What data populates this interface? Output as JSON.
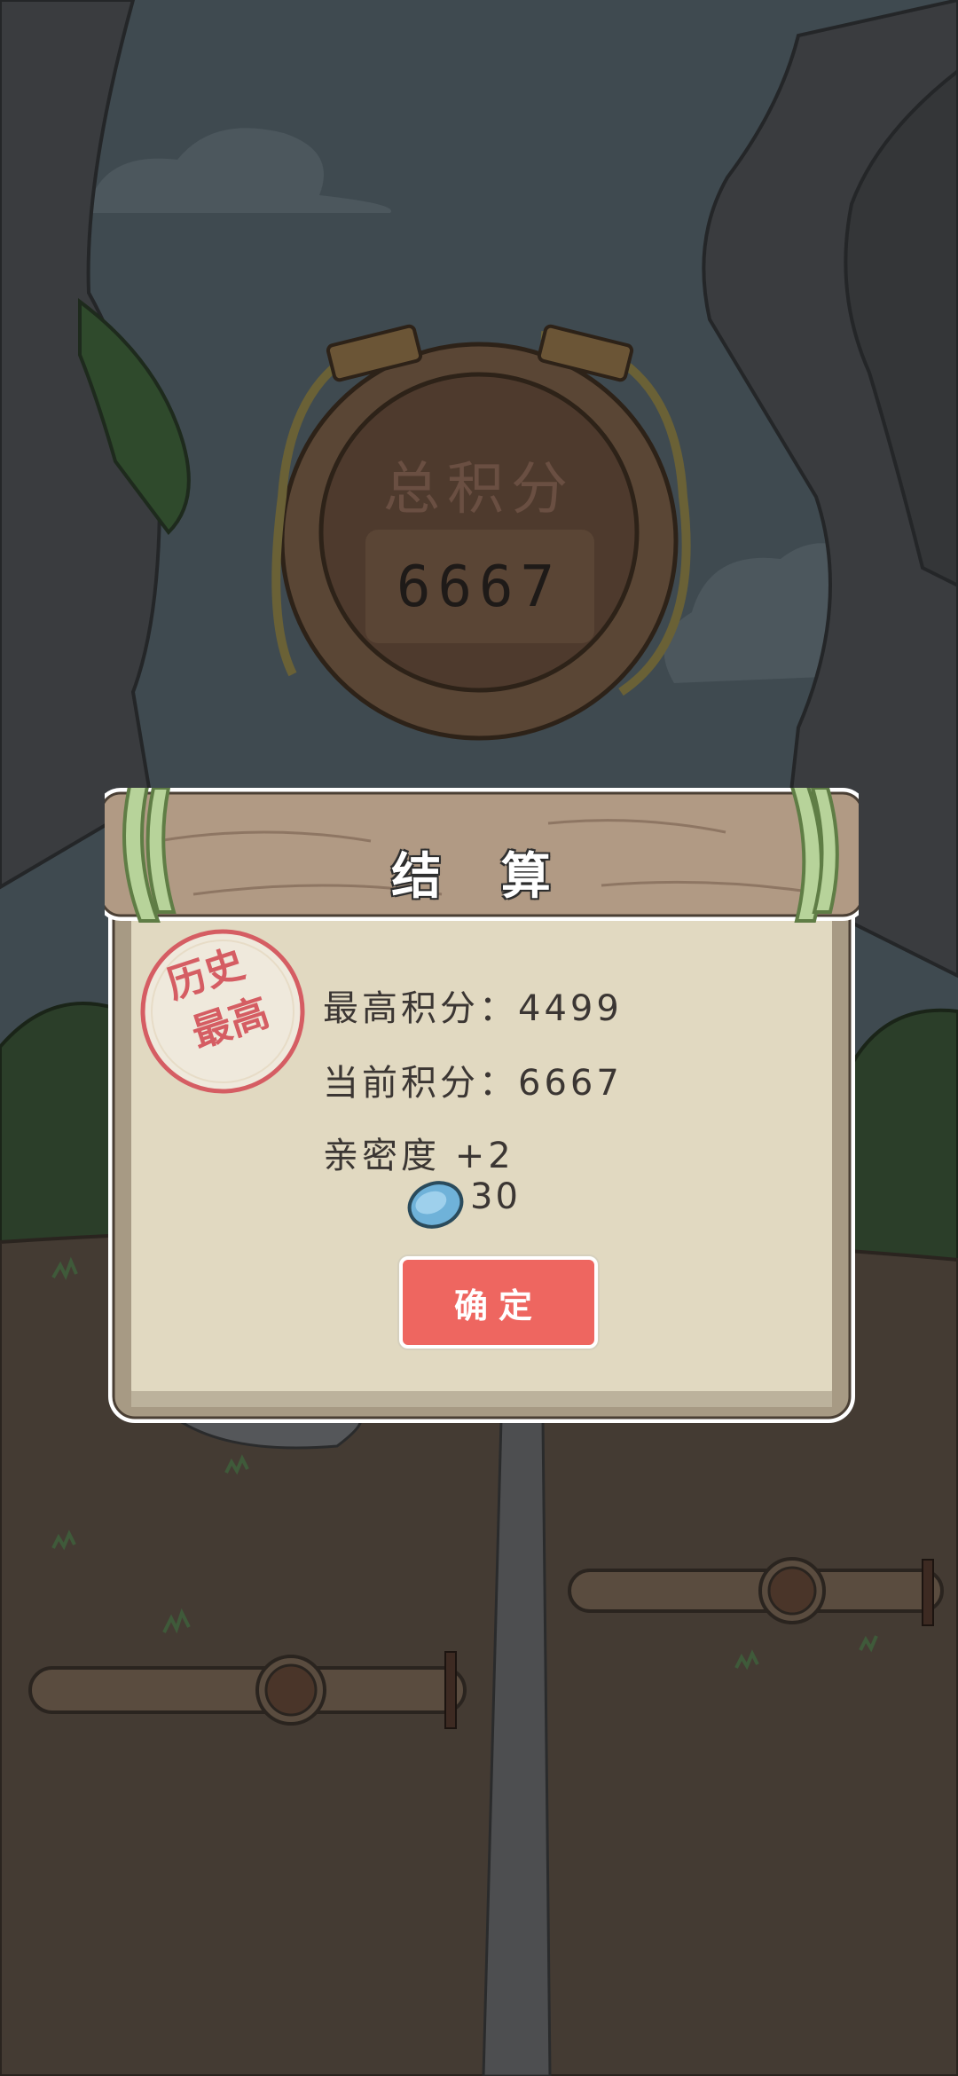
{
  "background": {
    "score_title": "总积分",
    "score_value": "6667",
    "colors": {
      "sky": "#3f4a50",
      "cliff": "#3a3c3f",
      "ground": "#443b33",
      "road": "#4d4e50"
    }
  },
  "dialog": {
    "title": "结 算",
    "stamp": {
      "line1": "历史",
      "line2": "最高",
      "color": "#d55d63"
    },
    "best_score_label": "最高积分：",
    "best_score_value": "4499",
    "current_score_label": "当前积分：",
    "current_score_value": "6667",
    "intimacy_label": "亲密度 +2",
    "coin_icon": "clover-coin-icon",
    "coin_value": "30",
    "confirm_label": "确定",
    "colors": {
      "confirm_button": "#ee6660",
      "paper": "#e1d9c1",
      "plank": "#b19a84"
    }
  }
}
